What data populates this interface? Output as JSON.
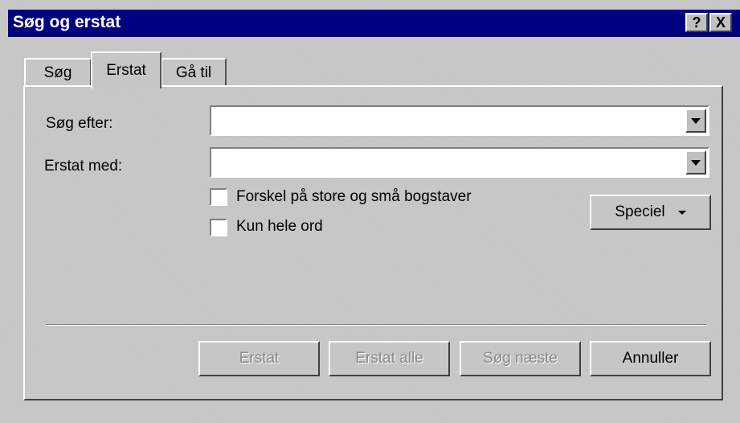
{
  "window": {
    "title": "Søg og erstat",
    "help_label": "?",
    "close_label": "X"
  },
  "tabs": [
    {
      "label": "Søg",
      "active": false
    },
    {
      "label": "Erstat",
      "active": true
    },
    {
      "label": "Gå til",
      "active": false
    }
  ],
  "form": {
    "search_label": "Søg efter:",
    "search_value": "",
    "replace_label": "Erstat med:",
    "replace_value": "",
    "checkbox_case_label": "Forskel på store og små bogstaver",
    "checkbox_case_checked": false,
    "checkbox_whole_label": "Kun hele ord",
    "checkbox_whole_checked": false,
    "special_label": "Speciel"
  },
  "buttons": {
    "replace": "Erstat",
    "replace_all": "Erstat alle",
    "find_next": "Søg næste",
    "cancel": "Annuller"
  }
}
